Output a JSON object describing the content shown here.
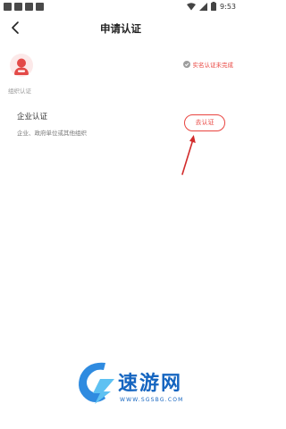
{
  "statusbar": {
    "time": "9:53"
  },
  "nav": {
    "title": "申请认证"
  },
  "org": {
    "label": "组织认证"
  },
  "auth_status": {
    "text": "实名认证未完成"
  },
  "card": {
    "title": "企业认证",
    "description": "企业、政府单位或其他组织",
    "button_label": "去认证"
  },
  "watermark": {
    "brand": "速游网",
    "url": "WWW.SGSBG.COM"
  },
  "colors": {
    "accent": "#e9443f",
    "watermark": "#1565c0"
  }
}
